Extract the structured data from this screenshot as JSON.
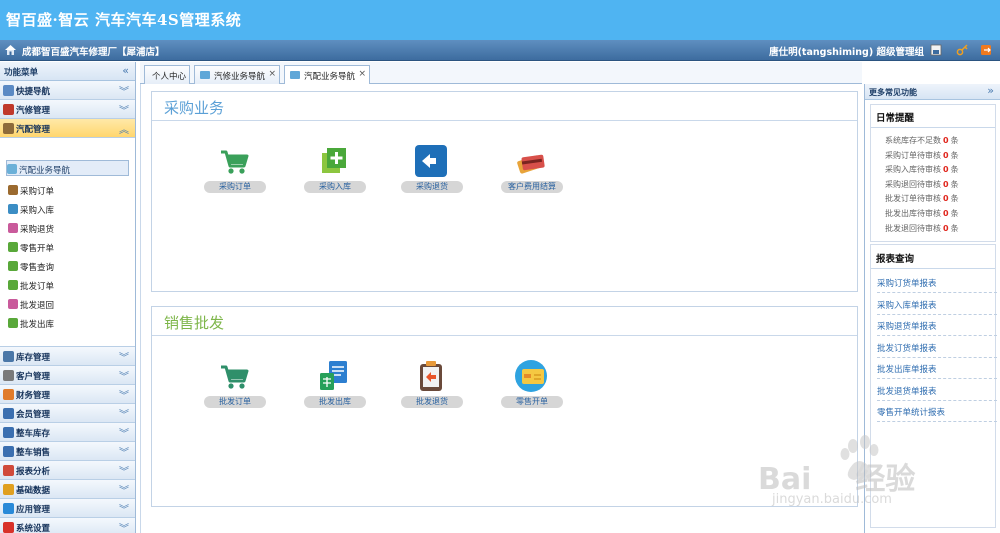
{
  "app": {
    "title": "智百盛·智云 汽车汽车4S管理系统"
  },
  "userbar": {
    "company": "成都智百盛汽车修理厂【犀浦店】",
    "user": "唐仕明(tangshiming) 超级管理组"
  },
  "sidebar": {
    "header": "功能菜单",
    "collapse_glyph": "«",
    "groups_top": [
      {
        "label": "快捷导航",
        "icon": "home-gear-icon",
        "color": "#5b8ac4"
      },
      {
        "label": "汽修管理",
        "icon": "tools-icon",
        "color": "#c0392b"
      },
      {
        "label": "汽配管理",
        "icon": "parts-icon",
        "color": "#8e6b3a",
        "active": true
      }
    ],
    "sub_items": [
      {
        "label": "汽配业务导航",
        "icon": "nav-icon",
        "color": "#6bb0d8",
        "selected": true
      },
      {
        "label": "采购订单",
        "icon": "order-icon",
        "color": "#9b6a2f"
      },
      {
        "label": "采购入库",
        "icon": "inbound-icon",
        "color": "#3b8dc4"
      },
      {
        "label": "采购退货",
        "icon": "return-icon",
        "color": "#c95a9b"
      },
      {
        "label": "零售开单",
        "icon": "leaf-icon",
        "color": "#59a83a"
      },
      {
        "label": "零售查询",
        "icon": "leaf-icon",
        "color": "#59a83a"
      },
      {
        "label": "批发订单",
        "icon": "leaf-icon",
        "color": "#59a83a"
      },
      {
        "label": "批发退回",
        "icon": "return-icon",
        "color": "#c95a9b"
      },
      {
        "label": "批发出库",
        "icon": "leaf-icon",
        "color": "#59a83a"
      }
    ],
    "groups_bottom": [
      {
        "label": "库存管理",
        "icon": "warehouse-icon",
        "color": "#4a77a8"
      },
      {
        "label": "客户管理",
        "icon": "customer-icon",
        "color": "#7a7a7a"
      },
      {
        "label": "财务管理",
        "icon": "finance-icon",
        "color": "#e07b2a"
      },
      {
        "label": "会员管理",
        "icon": "member-icon",
        "color": "#3b6fb0"
      },
      {
        "label": "整车库存",
        "icon": "car-stock-icon",
        "color": "#3b6fb0"
      },
      {
        "label": "整车销售",
        "icon": "car-sale-icon",
        "color": "#3b6fb0"
      },
      {
        "label": "报表分析",
        "icon": "pie-chart-icon",
        "color": "#d04a3a"
      },
      {
        "label": "基础数据",
        "icon": "database-icon",
        "color": "#e0a020"
      },
      {
        "label": "应用管理",
        "icon": "app-icon",
        "color": "#2a8ad8"
      },
      {
        "label": "系统设置",
        "icon": "settings-icon",
        "color": "#d8322a"
      }
    ],
    "expand_glyph": "»",
    "collapse_group_glyph": "⌄"
  },
  "tabs": [
    {
      "label": "个人中心",
      "closable": false
    },
    {
      "label": "汽修业务导航",
      "closable": true
    },
    {
      "label": "汽配业务导航",
      "closable": true,
      "active": true
    }
  ],
  "tab_close": "×",
  "purchase": {
    "title": "采购业务",
    "items": [
      {
        "label": "采购订单",
        "icon": "cart-icon"
      },
      {
        "label": "采购入库",
        "icon": "add-stock-icon"
      },
      {
        "label": "采购退货",
        "icon": "return-arrow-icon"
      },
      {
        "label": "客户费用结算",
        "icon": "cards-icon"
      }
    ]
  },
  "sales": {
    "title": "销售批发",
    "items": [
      {
        "label": "批发订单",
        "icon": "cart-icon"
      },
      {
        "label": "批发出库",
        "icon": "document-icon"
      },
      {
        "label": "批发退货",
        "icon": "clipboard-return-icon"
      },
      {
        "label": "零售开单",
        "icon": "card-icon"
      }
    ]
  },
  "right": {
    "header": "更多常见功能",
    "expand": "»",
    "daily_title": "日常提醒",
    "reminders": [
      {
        "label": "系统库存不足数",
        "count": "0",
        "unit": "条"
      },
      {
        "label": "采购订单待审核",
        "count": "0",
        "unit": "条"
      },
      {
        "label": "采购入库待审核",
        "count": "0",
        "unit": "条"
      },
      {
        "label": "采购退回待审核",
        "count": "0",
        "unit": "条"
      },
      {
        "label": "批发订单待审核",
        "count": "0",
        "unit": "条"
      },
      {
        "label": "批发出库待审核",
        "count": "0",
        "unit": "条"
      },
      {
        "label": "批发退回待审核",
        "count": "0",
        "unit": "条"
      }
    ],
    "reports_title": "报表查询",
    "reports": [
      "采购订货单报表",
      "采购入库单报表",
      "采购退货单报表",
      "批发订货单报表",
      "批发出库单报表",
      "批发退货单报表",
      "零售开单统计报表"
    ]
  },
  "watermark": {
    "brand": "Bai",
    "brand_tail": "经验",
    "url": "jingyan.baidu.com"
  }
}
